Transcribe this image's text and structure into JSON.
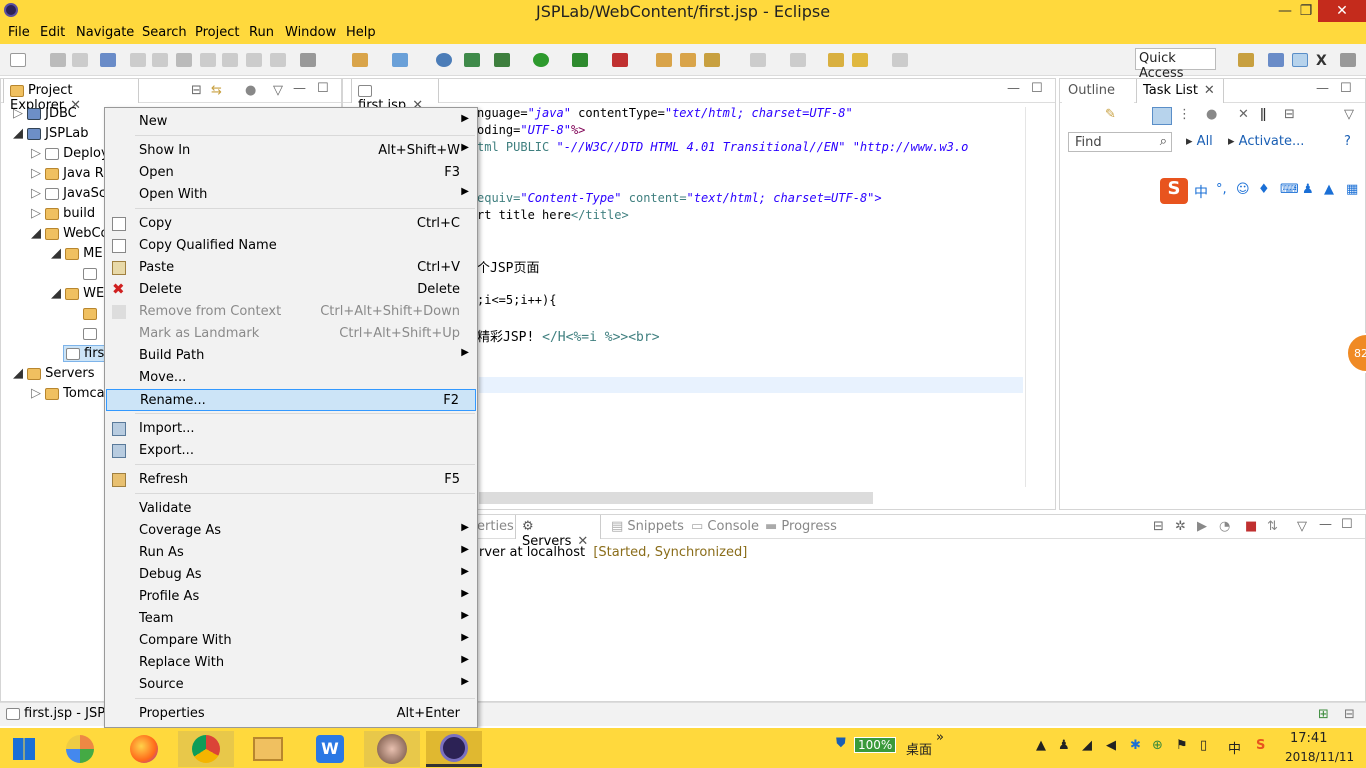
{
  "window": {
    "title": "JSPLab/WebContent/first.jsp - Eclipse"
  },
  "menubar": [
    "File",
    "Edit",
    "Navigate",
    "Search",
    "Project",
    "Run",
    "Window",
    "Help"
  ],
  "toolbar": {
    "quick_access": "Quick Access"
  },
  "project_explorer": {
    "title": "Project Explorer",
    "tree": [
      "JDBC",
      "JSPLab",
      "Deploy",
      "Java R",
      "JavaSc",
      "build",
      "WebCo",
      "ME",
      "",
      "WE",
      "",
      "",
      "firs",
      "Servers",
      "Tomca"
    ]
  },
  "editor": {
    "tab": "first.jsp",
    "lines": [
      {
        "pre": "nguage=",
        "s1": "\"java\"",
        "mid": " contentType=",
        "s2": "\"text/html; charset=UTF-8\""
      },
      {
        "pre": "oding=",
        "s1": "\"UTF-8\"",
        "mid": "%>",
        "s2": ""
      },
      {
        "pre": "tml PUBLIC ",
        "s1": "\"-//W3C//DTD HTML 4.01 Transitional//EN\"",
        "mid": " ",
        "s2": "\"http://www.w3.o"
      },
      {
        "pre": "equiv=",
        "s1": "\"Content-Type\"",
        "mid": " content=",
        "s2": "\"text/html; charset=UTF-8\">"
      },
      {
        "pre": "rt title here",
        "s1": "</title>",
        "mid": "",
        "s2": ""
      },
      {
        "pre": "个JSP页面",
        "s1": "",
        "mid": "",
        "s2": ""
      },
      {
        "pre": ";i<=5;i++){",
        "s1": "",
        "mid": "",
        "s2": ""
      },
      {
        "pre": "精彩JSP! ",
        "s1": "</H<%=i %>><br>",
        "mid": "",
        "s2": ""
      }
    ]
  },
  "task_list": {
    "outline_tab": "Outline",
    "tab": "Task List",
    "find_placeholder": "Find",
    "all": "All",
    "activate": "Activate..."
  },
  "servers_panel": {
    "tabs": [
      "erties",
      "Servers",
      "Snippets",
      "Console",
      "Progress"
    ],
    "server_text": "rver at localhost",
    "server_status": "[Started, Synchronized]"
  },
  "context_menu": {
    "items": [
      {
        "label": "New",
        "shortcut": "",
        "submenu": true,
        "disabled": false
      },
      {
        "label": "Show In",
        "shortcut": "Alt+Shift+W",
        "submenu": true,
        "disabled": false
      },
      {
        "label": "Open",
        "shortcut": "F3",
        "submenu": false,
        "disabled": false
      },
      {
        "label": "Open With",
        "shortcut": "",
        "submenu": true,
        "disabled": false
      },
      {
        "label": "Copy",
        "shortcut": "Ctrl+C",
        "submenu": false,
        "disabled": false
      },
      {
        "label": "Copy Qualified Name",
        "shortcut": "",
        "submenu": false,
        "disabled": false
      },
      {
        "label": "Paste",
        "shortcut": "Ctrl+V",
        "submenu": false,
        "disabled": false
      },
      {
        "label": "Delete",
        "shortcut": "Delete",
        "submenu": false,
        "disabled": false
      },
      {
        "label": "Remove from Context",
        "shortcut": "Ctrl+Alt+Shift+Down",
        "submenu": false,
        "disabled": true
      },
      {
        "label": "Mark as Landmark",
        "shortcut": "Ctrl+Alt+Shift+Up",
        "submenu": false,
        "disabled": true
      },
      {
        "label": "Build Path",
        "shortcut": "",
        "submenu": true,
        "disabled": false
      },
      {
        "label": "Move...",
        "shortcut": "",
        "submenu": false,
        "disabled": false
      },
      {
        "label": "Rename...",
        "shortcut": "F2",
        "submenu": false,
        "disabled": false,
        "selected": true
      },
      {
        "label": "Import...",
        "shortcut": "",
        "submenu": false,
        "disabled": false
      },
      {
        "label": "Export...",
        "shortcut": "",
        "submenu": false,
        "disabled": false
      },
      {
        "label": "Refresh",
        "shortcut": "F5",
        "submenu": false,
        "disabled": false
      },
      {
        "label": "Validate",
        "shortcut": "",
        "submenu": false,
        "disabled": false
      },
      {
        "label": "Coverage As",
        "shortcut": "",
        "submenu": true,
        "disabled": false
      },
      {
        "label": "Run As",
        "shortcut": "",
        "submenu": true,
        "disabled": false
      },
      {
        "label": "Debug As",
        "shortcut": "",
        "submenu": true,
        "disabled": false
      },
      {
        "label": "Profile As",
        "shortcut": "",
        "submenu": true,
        "disabled": false
      },
      {
        "label": "Team",
        "shortcut": "",
        "submenu": true,
        "disabled": false
      },
      {
        "label": "Compare With",
        "shortcut": "",
        "submenu": true,
        "disabled": false
      },
      {
        "label": "Replace With",
        "shortcut": "",
        "submenu": true,
        "disabled": false
      },
      {
        "label": "Source",
        "shortcut": "",
        "submenu": true,
        "disabled": false
      },
      {
        "label": "Properties",
        "shortcut": "Alt+Enter",
        "submenu": false,
        "disabled": false
      }
    ]
  },
  "statusbar": {
    "text": "first.jsp - JSPL"
  },
  "taskbar": {
    "battery": "100%",
    "desktop": "桌面",
    "time": "17:41",
    "date": "2018/11/11",
    "ime": "中"
  },
  "ime_toolbar": {
    "label": "中"
  },
  "badge": "82"
}
